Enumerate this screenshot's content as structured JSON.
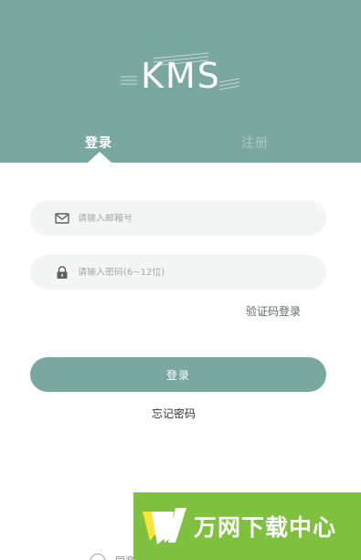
{
  "brand": {
    "logo_text": "KMS"
  },
  "tabs": {
    "login": "登录",
    "register": "注册"
  },
  "email_field": {
    "placeholder": "请输入邮箱号",
    "value": ""
  },
  "password_field": {
    "placeholder": "请输入密码(6~12位)",
    "value": ""
  },
  "sms_login_label": "验证码登录",
  "login_button_label": "登录",
  "forgot_password_label": "忘记密码",
  "agreement": {
    "text": "同意"
  },
  "watermark": {
    "text": "万网下载中心"
  },
  "colors": {
    "primary": "#7aa8a1",
    "field_bg": "#f3f4f4",
    "watermark_bg": "#7fc13f"
  },
  "icons": {
    "email": "mail-icon",
    "password": "lock-icon"
  }
}
